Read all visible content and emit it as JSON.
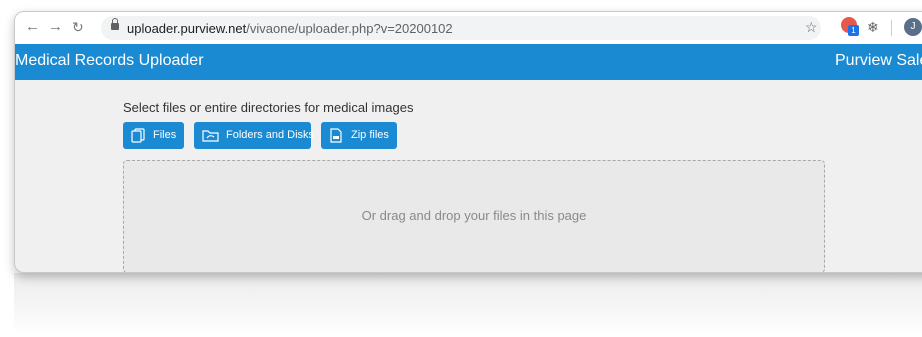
{
  "browser": {
    "url_host": "uploader.purview.net",
    "url_path": "/vivaone/uploader.php?v=20200102",
    "extension_badge_count": "1",
    "profile_initial": "J"
  },
  "header": {
    "title": "Medical Records Uploader",
    "right_label": "Purview Sales"
  },
  "main": {
    "prompt": "Select files or entire directories for medical images",
    "buttons": {
      "files": "Files",
      "folders": "Folders and Disks",
      "zip": "Zip files"
    },
    "dropzone_text": "Or drag and drop your files in this page"
  }
}
